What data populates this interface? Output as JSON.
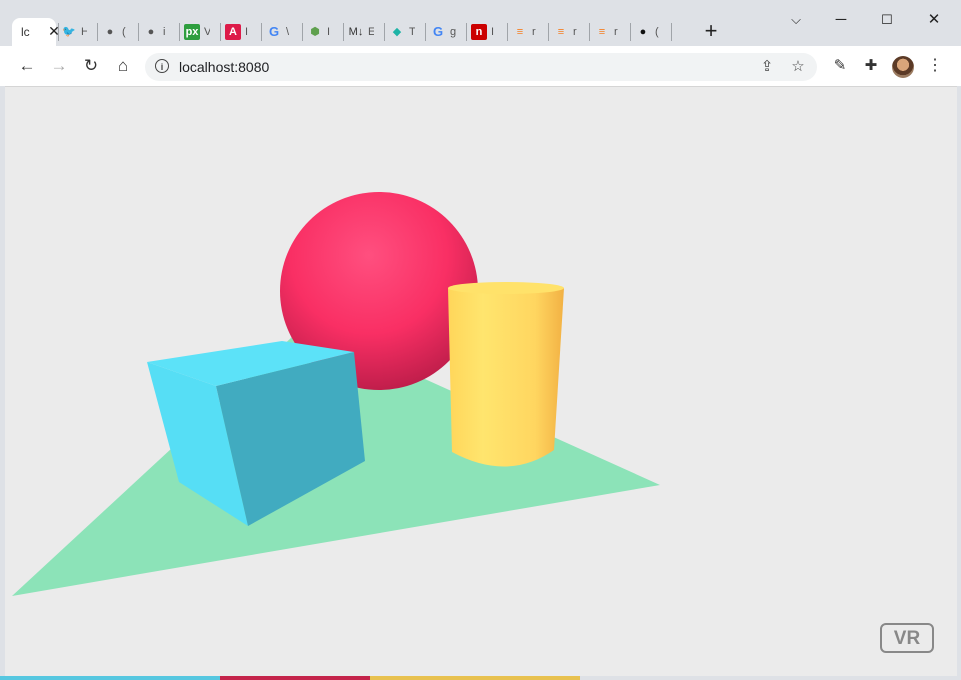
{
  "browser": {
    "active_tab": {
      "title": "lc",
      "icon": "page-icon"
    },
    "tabs": [
      {
        "icon": "twitter-icon",
        "glyph": "🐦",
        "color": "#1da1f2",
        "title": "H"
      },
      {
        "icon": "globe-icon",
        "glyph": "●",
        "color": "#555555",
        "title": "("
      },
      {
        "icon": "globe-icon",
        "glyph": "●",
        "color": "#555555",
        "title": "i"
      },
      {
        "icon": "px-icon",
        "glyph": "px",
        "color": "#2e9e3e",
        "title": "V"
      },
      {
        "icon": "angular-icon",
        "glyph": "A",
        "color": "#dd1b49",
        "title": "I"
      },
      {
        "icon": "google-icon",
        "glyph": "G",
        "color": "#4285f4",
        "title": "\\"
      },
      {
        "icon": "nodejs-icon",
        "glyph": "⬢",
        "color": "#5fa04e",
        "title": "I"
      },
      {
        "icon": "markdown-icon",
        "glyph": "M↓",
        "color": "#333333",
        "title": "E"
      },
      {
        "icon": "diamond-icon",
        "glyph": "◆",
        "color": "#1db3a6",
        "title": "T"
      },
      {
        "icon": "google-icon",
        "glyph": "G",
        "color": "#4285f4",
        "title": "g"
      },
      {
        "icon": "npm-icon",
        "glyph": "n",
        "color": "#cb0000",
        "title": "I"
      },
      {
        "icon": "stackoverflow-icon",
        "glyph": "≡",
        "color": "#f48024",
        "title": "r"
      },
      {
        "icon": "stackoverflow-icon",
        "glyph": "≡",
        "color": "#f48024",
        "title": "r"
      },
      {
        "icon": "stackoverflow-icon",
        "glyph": "≡",
        "color": "#f48024",
        "title": "r"
      },
      {
        "icon": "github-icon",
        "glyph": "●",
        "color": "#111111",
        "title": "("
      }
    ],
    "url": "localhost:8080"
  },
  "scene": {
    "colors": {
      "background": "#ebebeb",
      "plane": "#8ce3b8",
      "sphere": "#ff3366",
      "cylinder": "#ffe065",
      "box_front": "#56def5",
      "box_side": "#41abc0"
    }
  },
  "vr_button": {
    "label": "VR"
  }
}
